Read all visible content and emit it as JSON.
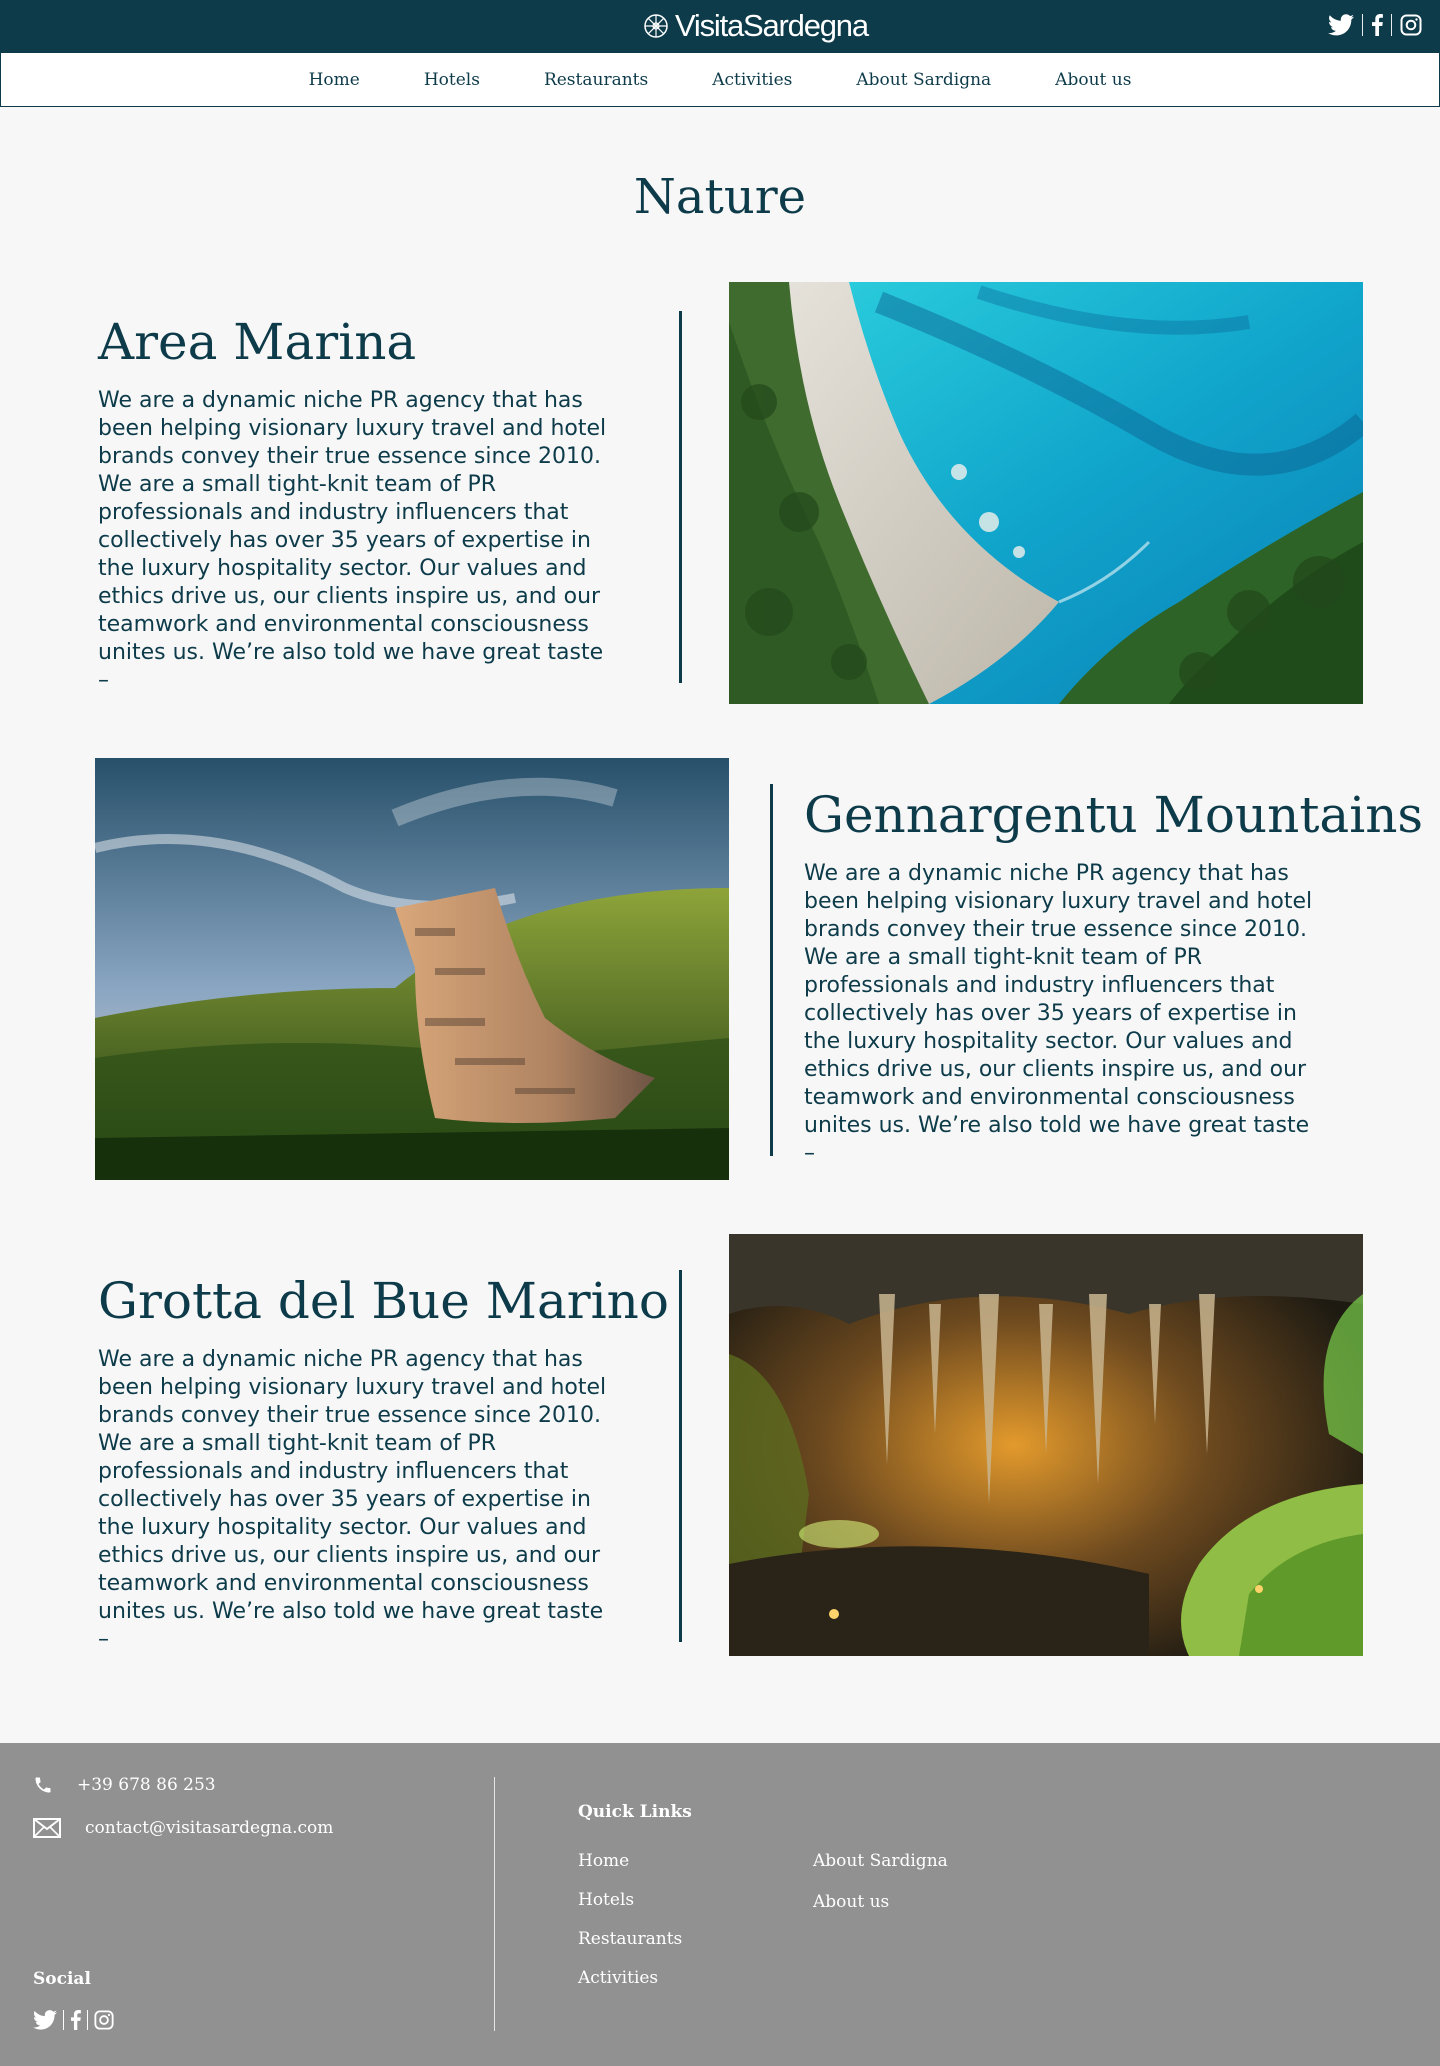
{
  "brand": {
    "name": "VisitaSardegna"
  },
  "nav": {
    "items": [
      {
        "label": "Home"
      },
      {
        "label": "Hotels"
      },
      {
        "label": "Restaurants"
      },
      {
        "label": "Activities"
      },
      {
        "label": "About Sardigna"
      },
      {
        "label": "About us"
      }
    ]
  },
  "page": {
    "title": "Nature"
  },
  "sections": [
    {
      "title": "Area Marina",
      "body": "We are a dynamic niche PR agency that has been helping visionary luxury travel and hotel brands convey their true essence since 2010. We are a small tight-knit team of PR professionals and industry influencers that collectively has over 35 years of expertise in the luxury hospitality sector. Our values and ethics drive us, our clients inspire us, and our teamwork and environmental consciousness unites us. We’re also told we have great taste –",
      "image": "coastline-aerial-photo"
    },
    {
      "title": "Gennargentu Mountains",
      "body": "We are a dynamic niche PR agency that has been helping visionary luxury travel and hotel brands convey their true essence since 2010. We are a small tight-knit team of PR professionals and industry influencers that collectively has over 35 years of expertise in the luxury hospitality sector. Our values and ethics drive us, our clients inspire us, and our teamwork and environmental consciousness unites us. We’re also told we have great taste –",
      "image": "stone-ruin-mountain-photo"
    },
    {
      "title": "Grotta del Bue Marino",
      "body": "We are a dynamic niche PR agency that has been helping visionary luxury travel and hotel brands convey their true essence since 2010. We are a small tight-knit team of PR professionals and industry influencers that collectively has over 35 years of expertise in the luxury hospitality sector. Our values and ethics drive us, our clients inspire us, and our teamwork and environmental consciousness unites us. We’re also told we have great taste –",
      "image": "cave-stalactites-photo"
    }
  ],
  "footer": {
    "phone": "+39 678 86 253",
    "email": "contact@visitasardegna.com",
    "quick_links_title": "Quick Links",
    "links_col1": [
      "Home",
      "Hotels",
      "Restaurants",
      "Activities"
    ],
    "links_col2": [
      "About Sardigna",
      "About us"
    ],
    "social_title": "Social"
  },
  "icons": [
    "twitter-icon",
    "facebook-icon",
    "instagram-icon",
    "phone-icon",
    "mail-icon",
    "logo-wheel-icon"
  ],
  "colors": {
    "brand_dark": "#0d3b4a",
    "footer_bg": "#919191",
    "page_bg": "#f7f7f7"
  }
}
